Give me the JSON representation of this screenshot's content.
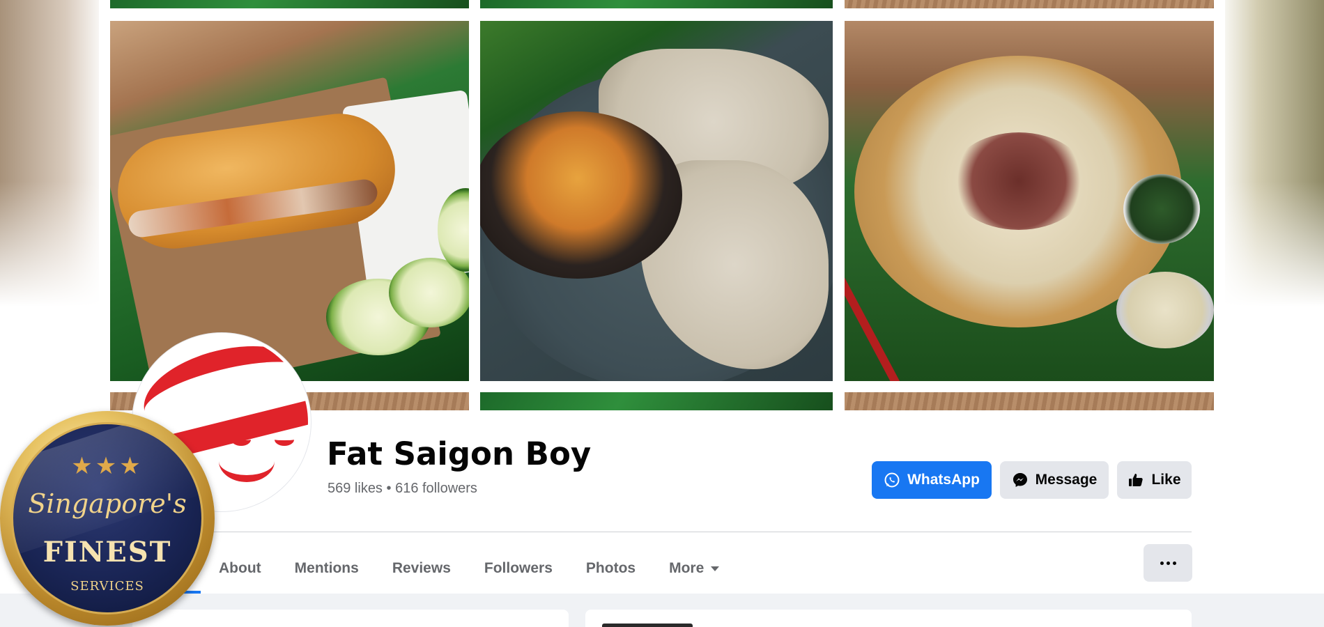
{
  "page": {
    "name": "Fat Saigon Boy",
    "likes": "569 likes",
    "separator": "•",
    "followers": "616 followers"
  },
  "actions": {
    "whatsapp_label": "WhatsApp",
    "message_label": "Message",
    "like_label": "Like"
  },
  "tabs": [
    {
      "label": "About"
    },
    {
      "label": "Mentions"
    },
    {
      "label": "Reviews"
    },
    {
      "label": "Followers"
    },
    {
      "label": "Photos"
    },
    {
      "label": "More"
    }
  ],
  "badge": {
    "stars": "★★★",
    "line1": "Singapore's",
    "line2": "FINEST",
    "line3": "SERVICES"
  },
  "colors": {
    "accent": "#1877f2",
    "brand_red": "#e0232a",
    "button_grey": "#e4e6eb"
  },
  "icons": [
    "whatsapp-icon",
    "messenger-icon",
    "thumbs-up-icon",
    "more-dots-icon",
    "caret-down-icon"
  ]
}
